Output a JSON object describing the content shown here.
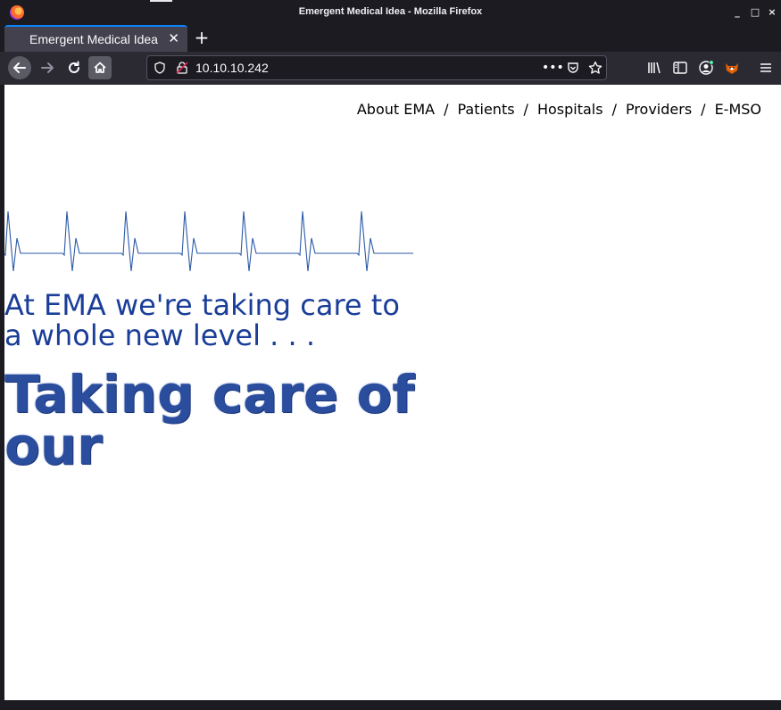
{
  "window": {
    "title": "Emergent Medical Idea - Mozilla Firefox",
    "controls": {
      "minimize": "_",
      "maximize": "□",
      "close": "×"
    }
  },
  "tabs": [
    {
      "label": "Emergent Medical Idea",
      "active": true
    }
  ],
  "toolbar": {
    "new_tab": "+",
    "url": "10.10.10.242",
    "page_actions": "•••"
  },
  "site": {
    "nav": {
      "separator": "/",
      "items": [
        "About EMA",
        "Patients",
        "Hospitals",
        "Providers",
        "E-MSO"
      ]
    },
    "tagline": "At EMA we're taking care to a whole new level . . .",
    "headline": "Taking care of our"
  },
  "colors": {
    "accent": "#0a84ff",
    "ekg_line": "#2b5aa8",
    "tagline": "#1a3e98",
    "headline": "#2a4d9e"
  }
}
